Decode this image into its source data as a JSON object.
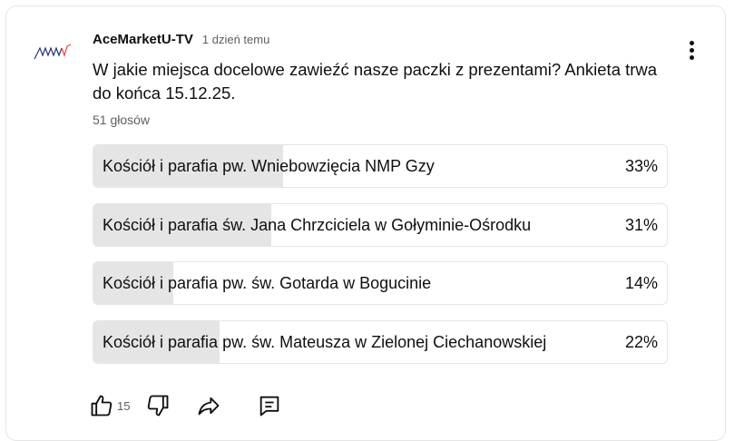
{
  "post": {
    "author": "AceMarketU-TV",
    "time": "1 dzień temu",
    "question": "W jakie miejsca docelowe zawieźć nasze paczki z prezentami? Ankieta trwa do końca 15.12.25.",
    "votes": "51 głosów"
  },
  "poll": {
    "options": [
      {
        "label": "Kościół i parafia pw. Wniebowzięcia NMP Gzy",
        "percent": "33%",
        "fraction": 0.33
      },
      {
        "label": "Kościół i parafia św. Jana Chrzciciela w Gołyminie-Ośrodku",
        "percent": "31%",
        "fraction": 0.31
      },
      {
        "label": "Kościół i parafia pw. św. Gotarda w Bogucinie",
        "percent": "14%",
        "fraction": 0.14
      },
      {
        "label": "Kościół i parafia pw. św. Mateusza w Zielonej Ciechanowskiej",
        "percent": "22%",
        "fraction": 0.22
      }
    ]
  },
  "actions": {
    "like_count": "15",
    "icons": [
      "thumb-up-icon",
      "thumb-down-icon",
      "share-icon",
      "comment-icon"
    ]
  },
  "colors": {
    "bar_fill": "#e5e5e5",
    "avatar_dark": "#1a2a6c",
    "avatar_red": "#e53935"
  }
}
